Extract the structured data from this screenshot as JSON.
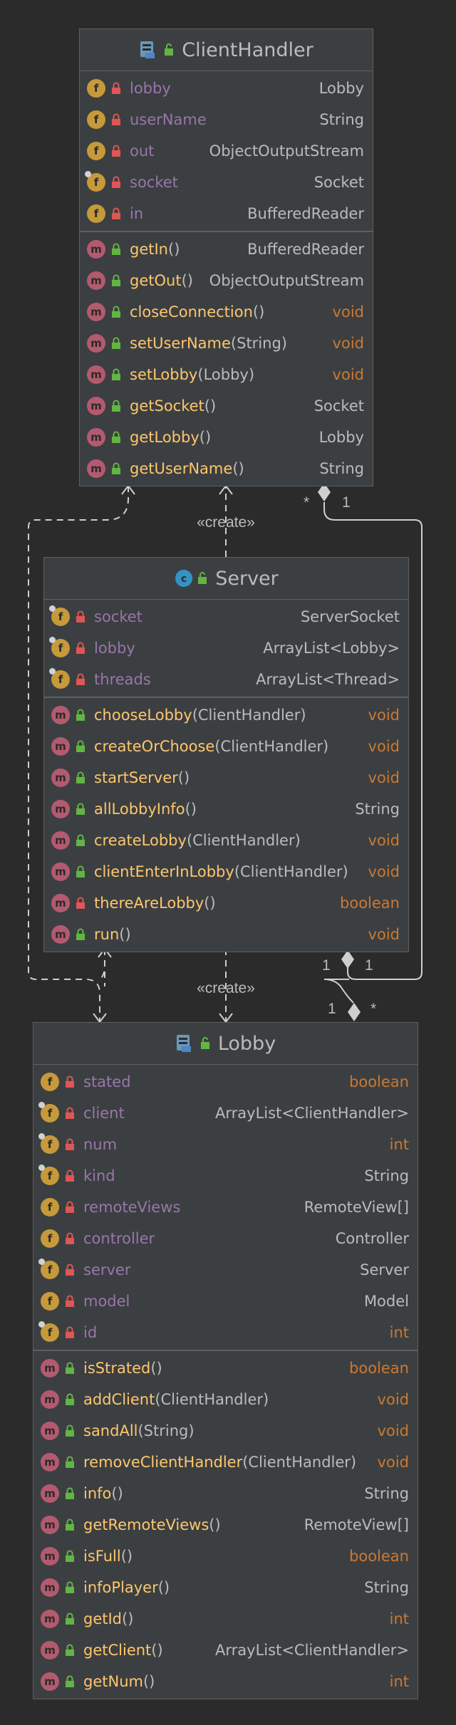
{
  "classes": {
    "client_handler": {
      "name": "ClientHandler",
      "fields": [
        {
          "name": "lobby",
          "type": "Lobby",
          "lock": "red",
          "final": false
        },
        {
          "name": "userName",
          "type": "String",
          "lock": "red",
          "final": false
        },
        {
          "name": "out",
          "type": "ObjectOutputStream",
          "lock": "red",
          "final": false
        },
        {
          "name": "socket",
          "type": "Socket",
          "lock": "red",
          "final": true
        },
        {
          "name": "in",
          "type": "BufferedReader",
          "lock": "red",
          "final": false
        }
      ],
      "methods": [
        {
          "name": "getIn",
          "params": "()",
          "type": "BufferedReader",
          "lock": "green"
        },
        {
          "name": "getOut",
          "params": "()",
          "type": "ObjectOutputStream",
          "lock": "green"
        },
        {
          "name": "closeConnection",
          "params": "()",
          "type": "void",
          "lock": "green"
        },
        {
          "name": "setUserName",
          "params": "(String)",
          "type": "void",
          "lock": "green"
        },
        {
          "name": "setLobby",
          "params": "(Lobby)",
          "type": "void",
          "lock": "green"
        },
        {
          "name": "getSocket",
          "params": "()",
          "type": "Socket",
          "lock": "green"
        },
        {
          "name": "getLobby",
          "params": "()",
          "type": "Lobby",
          "lock": "green"
        },
        {
          "name": "getUserName",
          "params": "()",
          "type": "String",
          "lock": "green"
        }
      ]
    },
    "server": {
      "name": "Server",
      "fields": [
        {
          "name": "socket",
          "type": "ServerSocket",
          "lock": "red",
          "final": true
        },
        {
          "name": "lobby",
          "type": "ArrayList<Lobby>",
          "lock": "red",
          "final": true
        },
        {
          "name": "threads",
          "type": "ArrayList<Thread>",
          "lock": "red",
          "final": true
        }
      ],
      "methods": [
        {
          "name": "chooseLobby",
          "params": "(ClientHandler)",
          "type": "void",
          "lock": "green"
        },
        {
          "name": "createOrChoose",
          "params": "(ClientHandler)",
          "type": "void",
          "lock": "green"
        },
        {
          "name": "startServer",
          "params": "()",
          "type": "void",
          "lock": "green"
        },
        {
          "name": "allLobbyInfo",
          "params": "()",
          "type": "String",
          "lock": "green"
        },
        {
          "name": "createLobby",
          "params": "(ClientHandler)",
          "type": "void",
          "lock": "green"
        },
        {
          "name": "clientEnterInLobby",
          "params": "(ClientHandler)",
          "type": "void",
          "lock": "green"
        },
        {
          "name": "thereAreLobby",
          "params": "()",
          "type": "boolean",
          "lock": "red"
        },
        {
          "name": "run",
          "params": "()",
          "type": "void",
          "lock": "green"
        }
      ]
    },
    "lobby": {
      "name": "Lobby",
      "fields": [
        {
          "name": "stated",
          "type": "boolean",
          "lock": "red",
          "final": false
        },
        {
          "name": "client",
          "type": "ArrayList<ClientHandler>",
          "lock": "red",
          "final": true
        },
        {
          "name": "num",
          "type": "int",
          "lock": "red",
          "final": true
        },
        {
          "name": "kind",
          "type": "String",
          "lock": "red",
          "final": true
        },
        {
          "name": "remoteViews",
          "type": "RemoteView[]",
          "lock": "red",
          "final": false
        },
        {
          "name": "controller",
          "type": "Controller",
          "lock": "red",
          "final": false
        },
        {
          "name": "server",
          "type": "Server",
          "lock": "red",
          "final": true
        },
        {
          "name": "model",
          "type": "Model",
          "lock": "red",
          "final": false
        },
        {
          "name": "id",
          "type": "int",
          "lock": "red",
          "final": true
        }
      ],
      "methods": [
        {
          "name": "isStrated",
          "params": "()",
          "type": "boolean",
          "lock": "green"
        },
        {
          "name": "addClient",
          "params": "(ClientHandler)",
          "type": "void",
          "lock": "green"
        },
        {
          "name": "sandAll",
          "params": "(String)",
          "type": "void",
          "lock": "green"
        },
        {
          "name": "removeClientHandler",
          "params": "(ClientHandler)",
          "type": "void",
          "lock": "green"
        },
        {
          "name": "info",
          "params": "()",
          "type": "String",
          "lock": "green"
        },
        {
          "name": "getRemoteViews",
          "params": "()",
          "type": "RemoteView[]",
          "lock": "green"
        },
        {
          "name": "isFull",
          "params": "()",
          "type": "boolean",
          "lock": "green"
        },
        {
          "name": "infoPlayer",
          "params": "()",
          "type": "String",
          "lock": "green"
        },
        {
          "name": "getId",
          "params": "()",
          "type": "int",
          "lock": "green"
        },
        {
          "name": "getClient",
          "params": "()",
          "type": "ArrayList<ClientHandler>",
          "lock": "green"
        },
        {
          "name": "getNum",
          "params": "()",
          "type": "int",
          "lock": "green"
        }
      ]
    }
  },
  "relations": {
    "create_label": "«create»",
    "ch_server_star": "*",
    "ch_server_one": "1",
    "server_lobby_one_left": "1",
    "server_lobby_one_right": "1",
    "lobby_one": "1",
    "lobby_star": "*"
  },
  "colors": {
    "background": "#2b2b2b",
    "box": "#3c3f41",
    "border": "#5e6060",
    "field_name": "#9876aa",
    "method_name": "#ffc66d",
    "keyword": "#cc7832",
    "text": "#bbbbbb",
    "lock_private": "#e05555",
    "lock_public": "#62b543"
  }
}
